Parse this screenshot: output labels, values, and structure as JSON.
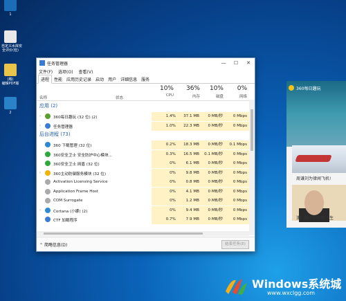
{
  "desktop": {
    "icons": [
      {
        "label": "1",
        "color": "#1c6db8"
      },
      {
        "label": "自定义水库安\n全评价(检)",
        "color": "#e8e8e8"
      },
      {
        "label": "(格)\n编辑PDF版",
        "color": "#e8c44a"
      },
      {
        "label": "2",
        "color": "#2a82c8"
      }
    ]
  },
  "taskmgr": {
    "title": "任务管理器",
    "menus": [
      "文件(F)",
      "选项(O)",
      "查看(V)"
    ],
    "tabs": [
      "进程",
      "性能",
      "应用历史记录",
      "启动",
      "用户",
      "详细信息",
      "服务"
    ],
    "active_tab": "进程",
    "columns": {
      "name": "名称",
      "status": "状态",
      "cpu": {
        "pct": "10%",
        "label": "CPU"
      },
      "mem": {
        "pct": "36%",
        "label": "内存"
      },
      "disk": {
        "pct": "10%",
        "label": "磁盘"
      },
      "net": {
        "pct": "0%",
        "label": "网络"
      }
    },
    "groups": [
      {
        "title": "应用 (2)",
        "rows": [
          {
            "name": "360每日趣玩 (32 位) (2)",
            "cpu": "1.4%",
            "mem": "37.1 MB",
            "disk": "0 MB/秒",
            "net": "0 Mbps",
            "icon": "#5aa02c",
            "expand": true
          },
          {
            "name": "任务管理器",
            "cpu": "1.0%",
            "mem": "22.3 MB",
            "disk": "0 MB/秒",
            "net": "0 Mbps",
            "icon": "#3a7bd5",
            "expand": true
          }
        ]
      },
      {
        "title": "后台进程 (73)",
        "rows": [
          {
            "name": "360 下载管理 (32 位)",
            "cpu": "0.2%",
            "mem": "18.3 MB",
            "disk": "0 MB/秒",
            "net": "0.1 Mbps",
            "icon": "#2b8ad6",
            "expand": false
          },
          {
            "name": "360安全卫士 安全防护中心模块...",
            "cpu": "0.3%",
            "mem": "16.5 MB",
            "disk": "0.1 MB/秒",
            "net": "0 Mbps",
            "icon": "#2eaa3a",
            "expand": false
          },
          {
            "name": "360安全卫士 网盾 (32 位)",
            "cpu": "0%",
            "mem": "6.1 MB",
            "disk": "0 MB/秒",
            "net": "0 Mbps",
            "icon": "#2eaa3a",
            "expand": false
          },
          {
            "name": "360主动防御服务模块 (32 位)",
            "cpu": "0%",
            "mem": "9.8 MB",
            "disk": "0 MB/秒",
            "net": "0 Mbps",
            "icon": "#f0b400",
            "expand": true
          },
          {
            "name": "Activation Licensing Service",
            "cpu": "0%",
            "mem": "0.8 MB",
            "disk": "0 MB/秒",
            "net": "0 Mbps",
            "icon": "#aaaaaa",
            "expand": false
          },
          {
            "name": "Application Frame Host",
            "cpu": "0%",
            "mem": "4.1 MB",
            "disk": "0 MB/秒",
            "net": "0 Mbps",
            "icon": "#aaaaaa",
            "expand": false
          },
          {
            "name": "COM Surrogate",
            "cpu": "0%",
            "mem": "1.2 MB",
            "disk": "0 MB/秒",
            "net": "0 Mbps",
            "icon": "#aaaaaa",
            "expand": false
          },
          {
            "name": "Cortana (小娜) (2)",
            "cpu": "0%",
            "mem": "9.4 MB",
            "disk": "0 MB/秒",
            "net": "0 Mbps",
            "icon": "#2b8ad6",
            "expand": true
          },
          {
            "name": "CTF 加载程序",
            "cpu": "0.7%",
            "mem": "7.9 MB",
            "disk": "0 MB/秒",
            "net": "0 Mbps",
            "icon": "#3a7bd5",
            "expand": false
          }
        ]
      }
    ],
    "footer": {
      "fewer": "简略信息(D)",
      "end_task": "结束任务(E)"
    },
    "heat_color": "#fff2c4"
  },
  "news": {
    "title": "360每日趣玩",
    "items": [
      {
        "caption": "周谦刘为律闻飞机!"
      },
      {
        "caption": "澳门赌王的传奇一生"
      }
    ]
  },
  "watermark": {
    "brand": "Windows系统城",
    "url": "www.wxclgg.com"
  }
}
